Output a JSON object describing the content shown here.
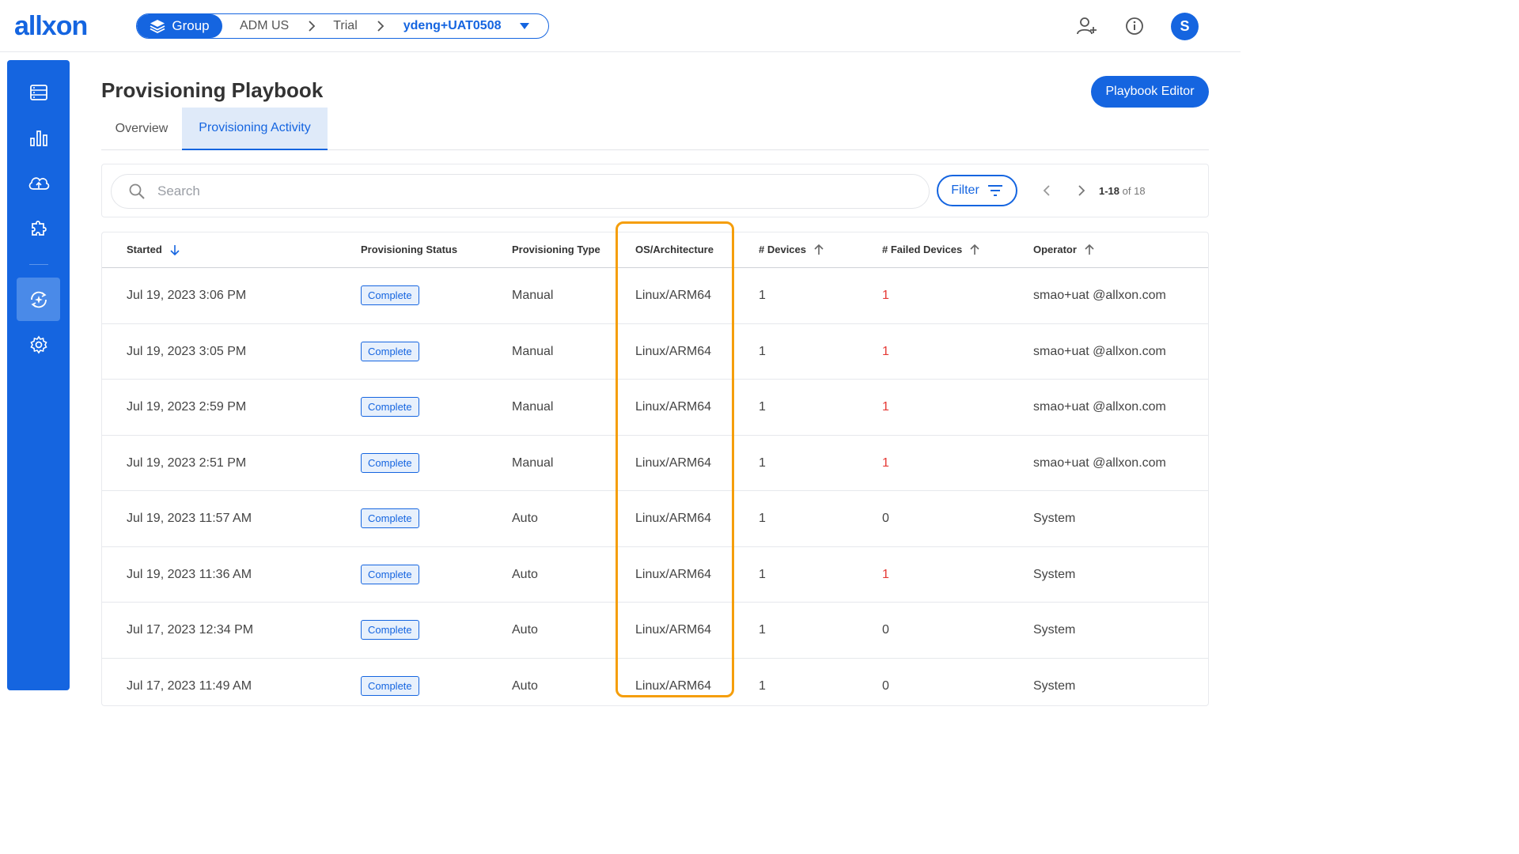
{
  "app": {
    "logo": "allxon"
  },
  "breadcrumb": {
    "group_label": "Group",
    "items": [
      "ADM US",
      "Trial"
    ],
    "current": "ydeng+UAT0508"
  },
  "user": {
    "avatar_initial": "S"
  },
  "page": {
    "title": "Provisioning Playbook",
    "playbook_editor_label": "Playbook Editor",
    "tabs": [
      {
        "label": "Overview",
        "active": false
      },
      {
        "label": "Provisioning Activity",
        "active": true
      }
    ]
  },
  "toolbar": {
    "search_placeholder": "Search",
    "search_value": "",
    "filter_label": "Filter",
    "pager_range": "1-18",
    "pager_total": "of 18"
  },
  "table": {
    "columns": [
      {
        "label": "Started",
        "sort": "down"
      },
      {
        "label": "Provisioning Status",
        "sort": ""
      },
      {
        "label": "Provisioning Type",
        "sort": ""
      },
      {
        "label": "OS/Architecture",
        "sort": ""
      },
      {
        "label": "# Devices",
        "sort": "up"
      },
      {
        "label": "# Failed Devices",
        "sort": "up"
      },
      {
        "label": "Operator",
        "sort": "up"
      }
    ],
    "rows": [
      {
        "started": "Jul 19, 2023 3:06 PM",
        "status": "Complete",
        "type": "Manual",
        "os": "Linux/ARM64",
        "devices": "1",
        "failed": "1",
        "operator": "smao+uat @allxon.com"
      },
      {
        "started": "Jul 19, 2023 3:05 PM",
        "status": "Complete",
        "type": "Manual",
        "os": "Linux/ARM64",
        "devices": "1",
        "failed": "1",
        "operator": "smao+uat @allxon.com"
      },
      {
        "started": "Jul 19, 2023 2:59 PM",
        "status": "Complete",
        "type": "Manual",
        "os": "Linux/ARM64",
        "devices": "1",
        "failed": "1",
        "operator": "smao+uat @allxon.com"
      },
      {
        "started": "Jul 19, 2023 2:51 PM",
        "status": "Complete",
        "type": "Manual",
        "os": "Linux/ARM64",
        "devices": "1",
        "failed": "1",
        "operator": "smao+uat @allxon.com"
      },
      {
        "started": "Jul 19, 2023 11:57 AM",
        "status": "Complete",
        "type": "Auto",
        "os": "Linux/ARM64",
        "devices": "1",
        "failed": "0",
        "operator": "System"
      },
      {
        "started": "Jul 19, 2023 11:36 AM",
        "status": "Complete",
        "type": "Auto",
        "os": "Linux/ARM64",
        "devices": "1",
        "failed": "1",
        "operator": "System"
      },
      {
        "started": "Jul 17, 2023 12:34 PM",
        "status": "Complete",
        "type": "Auto",
        "os": "Linux/ARM64",
        "devices": "1",
        "failed": "0",
        "operator": "System"
      },
      {
        "started": "Jul 17, 2023 11:49 AM",
        "status": "Complete",
        "type": "Auto",
        "os": "Linux/ARM64",
        "devices": "1",
        "failed": "0",
        "operator": "System"
      }
    ]
  },
  "colors": {
    "brand": "#1565e0",
    "failed": "#e53935",
    "highlight": "#f59e0b"
  }
}
